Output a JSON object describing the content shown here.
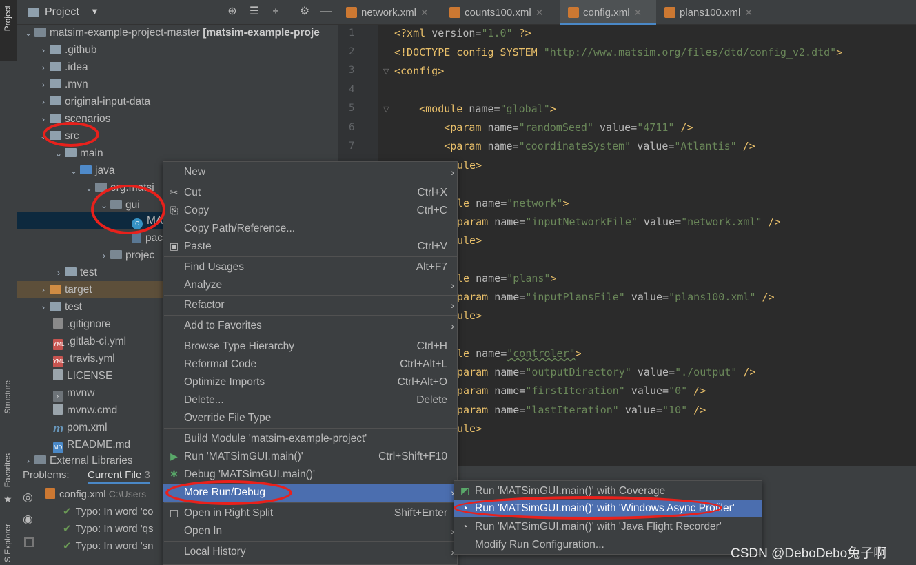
{
  "sidebar": {
    "project": "Project",
    "structure": "Structure",
    "favorites": "Favorites",
    "explorer": "S Explorer"
  },
  "project_header": {
    "title": "Project"
  },
  "tabs": [
    {
      "label": "network.xml"
    },
    {
      "label": "counts100.xml"
    },
    {
      "label": "config.xml"
    },
    {
      "label": "plans100.xml"
    }
  ],
  "tree": {
    "root": "matsim-example-project-master",
    "root_suffix": "[matsim-example-proje",
    "items": [
      ".github",
      ".idea",
      ".mvn",
      "original-input-data",
      "scenarios",
      "src",
      "main",
      "java",
      "org.matsi",
      "gui",
      "MAT",
      "pac",
      "projec",
      "test",
      "target",
      "test",
      ".gitignore",
      ".gitlab-ci.yml",
      ".travis.yml",
      "LICENSE",
      "mvnw",
      "mvnw.cmd",
      "pom.xml",
      "README.md",
      "External Libraries"
    ]
  },
  "editor": {
    "line_numbers": [
      "1",
      "2",
      "3",
      "4",
      "5",
      "6",
      "7"
    ],
    "lines": [
      {
        "a": "<?xml ",
        "b": "version=",
        "c": "\"1.0\"",
        "d": " ?>"
      },
      {
        "a": "<!DOCTYPE config SYSTEM ",
        "c": "\"http://www.matsim.org/files/dtd/config_v2.dtd\"",
        "d": ">"
      },
      {
        "a": "<config>"
      },
      {
        "a": ""
      },
      {
        "a": "    <module ",
        "b": "name=",
        "c": "\"global\"",
        "d": ">"
      },
      {
        "a": "        <param ",
        "b": "name=",
        "c": "\"randomSeed\"",
        "e": " value=",
        "f": "\"4711\"",
        "d": " />"
      },
      {
        "a": "        <param ",
        "b": "name=",
        "c": "\"coordinateSystem\"",
        "e": " value=",
        "f": "\"Atlantis\"",
        "d": " />"
      },
      {
        "a": "ule>"
      },
      {
        "a": "le ",
        "b": "name=",
        "c": "\"network\"",
        "d": ">"
      },
      {
        "a": "param ",
        "b": "name=",
        "c": "\"inputNetworkFile\"",
        "e": " value=",
        "f": "\"network.xml\"",
        "d": " />"
      },
      {
        "a": "ule>"
      },
      {
        "a": "le ",
        "b": "name=",
        "c": "\"plans\"",
        "d": ">"
      },
      {
        "a": "param ",
        "b": "name=",
        "c": "\"inputPlansFile\"",
        "e": " value=",
        "f": "\"plans100.xml\"",
        "d": " />"
      },
      {
        "a": "ule>"
      },
      {
        "a": "le ",
        "b": "name=",
        "c": "\"controler\"",
        "d": ">"
      },
      {
        "a": "param ",
        "b": "name=",
        "c": "\"outputDirectory\"",
        "e": " value=",
        "f": "\"./output\"",
        "d": " />"
      },
      {
        "a": "param ",
        "b": "name=",
        "c": "\"firstIteration\"",
        "e": " value=",
        "f": "\"0\"",
        "d": " />"
      },
      {
        "a": "param ",
        "b": "name=",
        "c": "\"lastIteration\"",
        "e": " value=",
        "f": "\"10\"",
        "d": " />"
      },
      {
        "a": "ule>"
      }
    ]
  },
  "problems": {
    "label": "Problems:",
    "tab": "Current File",
    "count": "3",
    "file": "config.xml",
    "path": "C:\\Users",
    "items": [
      "Typo: In word 'co",
      "Typo: In word 'qs",
      "Typo: In word 'sn"
    ]
  },
  "context_menu": {
    "items": [
      {
        "label": "New",
        "shortcut": "",
        "sub": true
      },
      {
        "label": "Cut",
        "shortcut": "Ctrl+X"
      },
      {
        "label": "Copy",
        "shortcut": "Ctrl+C"
      },
      {
        "label": "Copy Path/Reference...",
        "shortcut": ""
      },
      {
        "label": "Paste",
        "shortcut": "Ctrl+V"
      },
      {
        "label": "Find Usages",
        "shortcut": "Alt+F7"
      },
      {
        "label": "Analyze",
        "shortcut": "",
        "sub": true
      },
      {
        "label": "Refactor",
        "shortcut": "",
        "sub": true
      },
      {
        "label": "Add to Favorites",
        "shortcut": "",
        "sub": true
      },
      {
        "label": "Browse Type Hierarchy",
        "shortcut": "Ctrl+H"
      },
      {
        "label": "Reformat Code",
        "shortcut": "Ctrl+Alt+L"
      },
      {
        "label": "Optimize Imports",
        "shortcut": "Ctrl+Alt+O"
      },
      {
        "label": "Delete...",
        "shortcut": "Delete"
      },
      {
        "label": "Override File Type",
        "shortcut": ""
      },
      {
        "label": "Build Module 'matsim-example-project'",
        "shortcut": ""
      },
      {
        "label": "Run 'MATSimGUI.main()'",
        "shortcut": "Ctrl+Shift+F10"
      },
      {
        "label": "Debug 'MATSimGUI.main()'",
        "shortcut": ""
      },
      {
        "label": "More Run/Debug",
        "shortcut": "",
        "sub": true
      },
      {
        "label": "Open in Right Split",
        "shortcut": "Shift+Enter"
      },
      {
        "label": "Open In",
        "shortcut": "",
        "sub": true
      },
      {
        "label": "Local History",
        "shortcut": "",
        "sub": true
      }
    ]
  },
  "submenu": {
    "items": [
      "Run 'MATSimGUI.main()' with Coverage",
      "Run 'MATSimGUI.main()' with 'Windows Async Profiler'",
      "Run 'MATSimGUI.main()' with 'Java Flight Recorder'",
      "Modify Run Configuration..."
    ]
  },
  "watermark": "CSDN @DeboDebo兔子啊",
  "colors": {
    "accent": "#4b6eaf",
    "annotation": "#e8211c"
  }
}
